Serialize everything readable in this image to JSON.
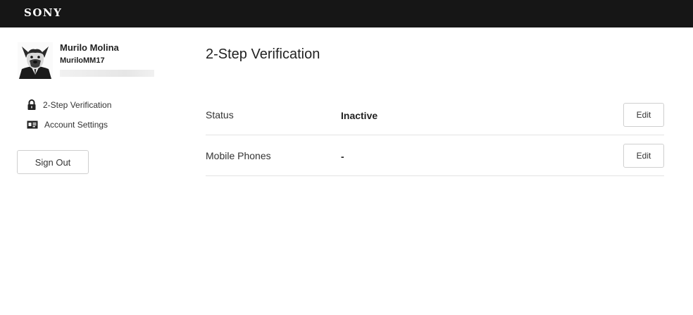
{
  "header": {
    "brand": "SONY"
  },
  "sidebar": {
    "user": {
      "name": "Murilo Molina",
      "handle": "MuriloMM17"
    },
    "nav": [
      {
        "label": "2-Step Verification",
        "icon": "lock-icon"
      },
      {
        "label": "Account Settings",
        "icon": "id-card-icon"
      }
    ],
    "sign_out_label": "Sign Out"
  },
  "main": {
    "title": "2-Step Verification",
    "rows": [
      {
        "label": "Status",
        "value": "Inactive",
        "action": "Edit"
      },
      {
        "label": "Mobile Phones",
        "value": "-",
        "action": "Edit"
      }
    ]
  },
  "colors": {
    "header_bg": "#161616",
    "divider": "#e3e3e3",
    "button_border": "#cfcfcf"
  }
}
